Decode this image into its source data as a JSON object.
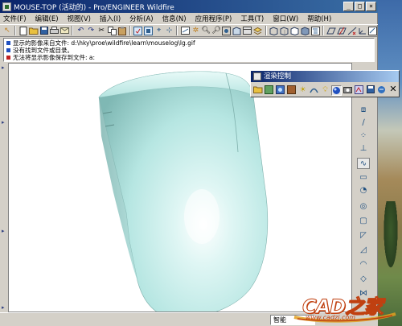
{
  "window": {
    "title": "MOUSE-TOP (活动的) - Pro/ENGINEER Wildfire",
    "minimize": "_",
    "maximize": "□",
    "close": "×"
  },
  "menu": [
    "文件(F)",
    "编辑(E)",
    "视图(V)",
    "插入(I)",
    "分析(A)",
    "信息(N)",
    "应用程序(P)",
    "工具(T)",
    "窗口(W)",
    "帮助(H)"
  ],
  "messages": [
    "显示的影像来自文件: d:\\hky\\proe\\wildfire\\learn\\mouselog\\lg.gif",
    "没有找到文件或目录。",
    "无法将显示影像保存到文件: a:"
  ],
  "render_panel": {
    "title": "渲染控制",
    "close": "✕"
  },
  "status": {
    "filter": "智能"
  },
  "watermark": {
    "brand": "CAD之家",
    "url": "www.cadzj.com"
  },
  "colors": {
    "model": "#b8e8e4",
    "title_bar": "#0a246a",
    "accent": "#c04010"
  }
}
